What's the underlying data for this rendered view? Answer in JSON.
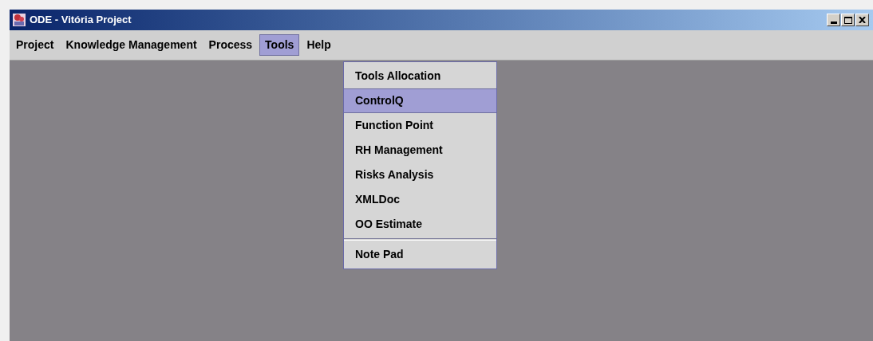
{
  "window": {
    "title": "ODE - Vitória Project"
  },
  "menu_bar": [
    {
      "label": "Project",
      "selected": false
    },
    {
      "label": "Knowledge Management",
      "selected": false
    },
    {
      "label": "Process",
      "selected": false
    },
    {
      "label": "Tools",
      "selected": true
    },
    {
      "label": "Help",
      "selected": false
    }
  ],
  "open_menu": {
    "items": [
      {
        "label": "Tools Allocation",
        "selected": false,
        "separator_before": false
      },
      {
        "label": "ControlQ",
        "selected": true,
        "separator_before": false
      },
      {
        "label": "Function Point",
        "selected": false,
        "separator_before": false
      },
      {
        "label": "RH Management",
        "selected": false,
        "separator_before": false
      },
      {
        "label": "Risks Analysis",
        "selected": false,
        "separator_before": false
      },
      {
        "label": "XMLDoc",
        "selected": false,
        "separator_before": false
      },
      {
        "label": "OO Estimate",
        "selected": false,
        "separator_before": false
      },
      {
        "label": "Note Pad",
        "selected": false,
        "separator_before": true
      }
    ]
  }
}
